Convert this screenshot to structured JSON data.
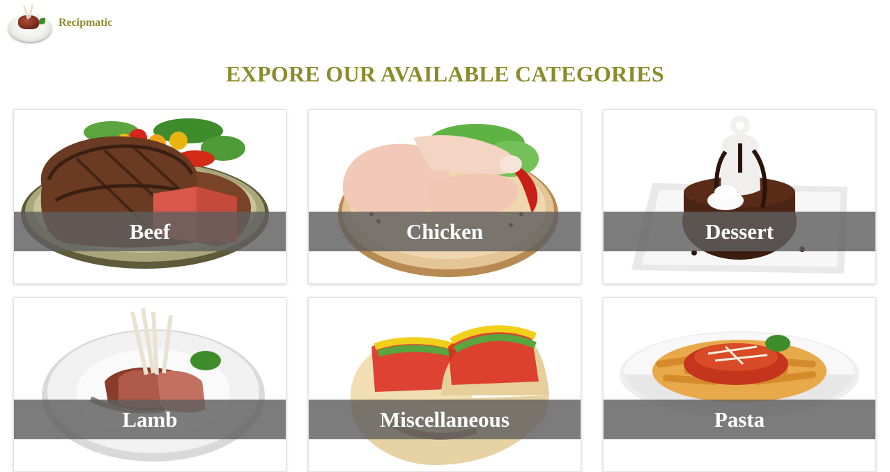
{
  "header": {
    "brand": "Recipmatic",
    "logo_icon": "lamb-plate-logo-icon"
  },
  "page_title": "EXPORE OUR AVAILABLE CATEGORIES",
  "colors": {
    "accent": "#8b8b2c",
    "label_bar": "#5f5f5f",
    "label_text": "#ffffff"
  },
  "categories": [
    {
      "label": "Beef",
      "image": "steak-plate-image"
    },
    {
      "label": "Chicken",
      "image": "raw-chicken-legs-image"
    },
    {
      "label": "Dessert",
      "image": "chocolate-lava-cake-image"
    },
    {
      "label": "Lamb",
      "image": "lamb-chops-plate-image"
    },
    {
      "label": "Miscellaneous",
      "image": "tacos-image"
    },
    {
      "label": "Pasta",
      "image": "penne-pasta-bowl-image"
    }
  ]
}
